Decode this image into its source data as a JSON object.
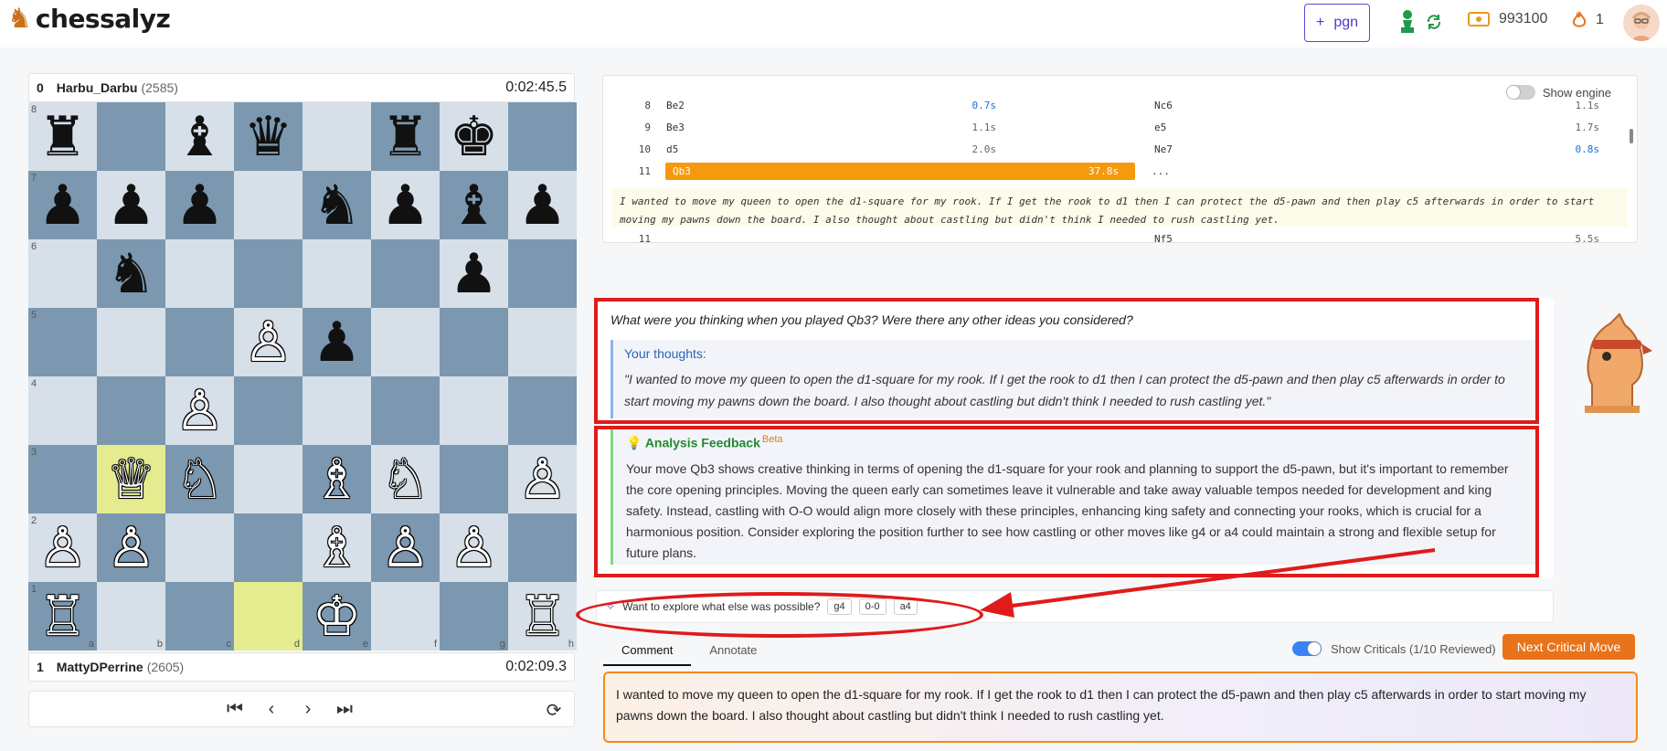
{
  "header": {
    "logo_text": "chessalyz",
    "pgn_label": "pgn",
    "points": "993100",
    "streak": "1"
  },
  "board": {
    "top_player": {
      "index": "0",
      "name": "Harbu_Darbu",
      "rating": "(2585)",
      "clock": "0:02:45.5"
    },
    "bottom_player": {
      "index": "1",
      "name": "MattyDPerrine",
      "rating": "(2605)",
      "clock": "0:02:09.3"
    },
    "ranks": [
      "8",
      "7",
      "6",
      "5",
      "4",
      "3",
      "2",
      "1"
    ],
    "files": [
      "a",
      "b",
      "c",
      "d",
      "e",
      "f",
      "g",
      "h"
    ],
    "position": [
      "♜",
      "",
      "♝",
      "♛",
      "",
      "♜",
      "♚",
      "",
      "♟",
      "♟",
      "♟",
      "",
      "♞",
      "♟",
      "♝",
      "♟",
      "",
      "♞",
      "",
      "",
      "",
      "",
      "♟",
      "",
      "",
      "",
      "",
      "♙",
      "♟",
      "",
      "",
      "",
      "",
      "",
      "♙",
      "",
      "",
      "",
      "",
      "",
      "",
      "♕",
      "♘",
      "",
      "♗",
      "♘",
      "",
      "♙",
      "♙",
      "♙",
      "",
      "",
      "♗",
      "♙",
      "♙",
      "",
      "♖",
      "",
      "",
      "",
      "♔",
      "",
      "",
      "♖"
    ],
    "highlighted": [
      "b3",
      "d1"
    ]
  },
  "moves_panel": {
    "show_engine_label": "Show engine",
    "rows": [
      {
        "num": "8",
        "white": "Be2",
        "white_time": "0.7s",
        "black": "Nc6",
        "black_time": "1.1s"
      },
      {
        "num": "9",
        "white": "Be3",
        "white_time": "1.1s",
        "black": "e5",
        "black_time": "1.7s"
      },
      {
        "num": "10",
        "white": "d5",
        "white_time": "2.0s",
        "black": "Ne7",
        "black_time": "0.8s"
      },
      {
        "num": "11",
        "white": "Qb3",
        "white_time": "37.8s",
        "black": "...",
        "black_time": ""
      },
      {
        "num": "11",
        "white": "",
        "white_time": "",
        "black": "Nf5",
        "black_time": "5.5s"
      }
    ],
    "comment": "I wanted to move my queen to open the d1-square for my rook. If I get the rook to d1 then I can protect the d5-pawn and then play c5 afterwards in order to start moving my pawns down the board. I also thought about castling but didn't think I needed to rush castling yet."
  },
  "feedback": {
    "question": "What were you thinking when you played Qb3? Were there any other ideas you considered?",
    "thoughts_title": "Your thoughts:",
    "thoughts_text": "\"I wanted to move my queen to open the d1-square for my rook. If I get the rook to d1 then I can protect the d5-pawn and then play c5 afterwards in order to start moving my pawns down the board. I also thought about castling but didn't think I needed to rush castling yet.\"",
    "analysis_title": "Analysis Feedback",
    "beta_label": "Beta",
    "analysis_text": "Your move Qb3 shows creative thinking in terms of opening the d1-square for your rook and planning to support the d5-pawn, but it's important to remember the core opening principles. Moving the queen early can sometimes leave it vulnerable and take away valuable tempos needed for development and king safety. Instead, castling with O-O would align more closely with these principles, enhancing king safety and connecting your rooks, which is crucial for a harmonious position. Consider exploring the position further to see how castling or other moves like g4 or a4 could maintain a strong and flexible setup for future plans."
  },
  "explore": {
    "prompt": "Want to explore what else was possible?",
    "chips": [
      "g4",
      "0-0",
      "a4"
    ]
  },
  "tabs": [
    "Comment",
    "Annotate"
  ],
  "criticals_label": "Show Criticals (1/10 Reviewed)",
  "next_button": "Next Critical Move",
  "comment_input": "I wanted to move my queen to open the d1-square for my rook. If I get the rook to d1 then I can protect the d5-pawn and then play c5 afterwards in order to start moving my pawns down the board. I also thought about castling but didn't think I needed to rush castling yet."
}
